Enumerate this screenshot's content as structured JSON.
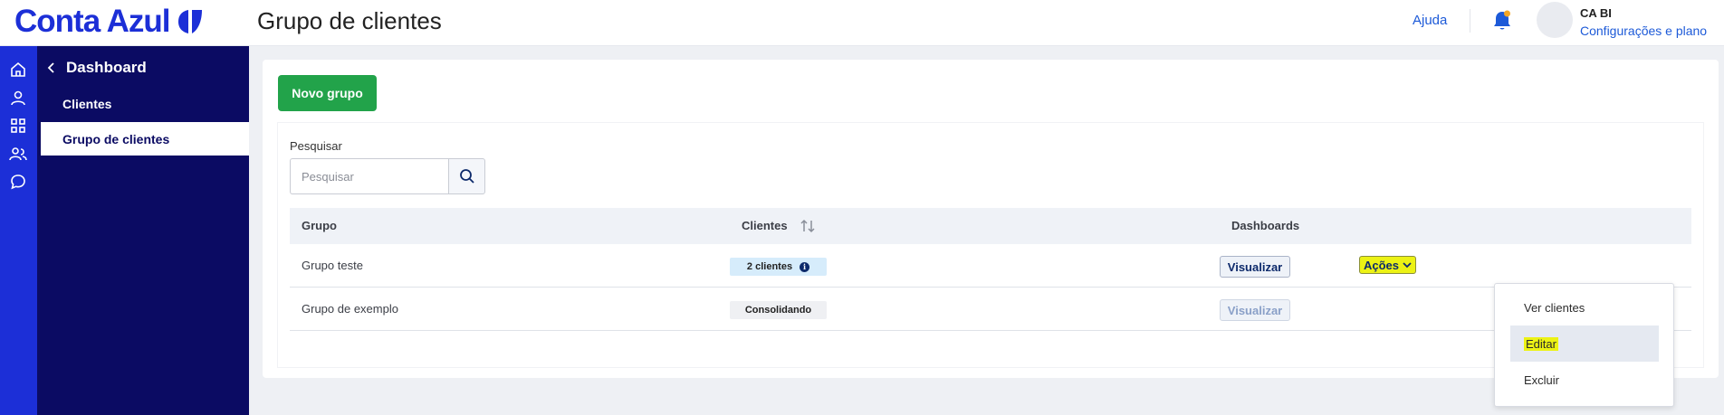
{
  "brand": {
    "name": "Conta Azul",
    "color": "#1c2fd7"
  },
  "header": {
    "title": "Grupo de clientes",
    "help": "Ajuda",
    "user_name": "CA BI",
    "user_link": "Configurações e plano"
  },
  "rail": {
    "icons": [
      "home-icon",
      "user-icon",
      "grid-icon",
      "users-icon",
      "chat-icon"
    ]
  },
  "sidebar": {
    "back_label": "Dashboard",
    "items": [
      {
        "label": "Clientes",
        "active": false
      },
      {
        "label": "Grupo de clientes",
        "active": true
      }
    ]
  },
  "toolbar": {
    "new_group": "Novo grupo"
  },
  "search": {
    "label": "Pesquisar",
    "placeholder": "Pesquisar",
    "value": ""
  },
  "table": {
    "columns": [
      "Grupo",
      "Clientes",
      "Dashboards"
    ],
    "rows": [
      {
        "group": "Grupo teste",
        "clients": "2 clientes",
        "view": "Visualizar",
        "actions": "Ações"
      },
      {
        "group": "Grupo de exemplo",
        "clients": "Consolidando",
        "view": "Visualizar"
      }
    ]
  },
  "dropdown": {
    "items": [
      "Ver clientes",
      "Editar",
      "Excluir"
    ],
    "highlighted": "Editar"
  },
  "colors": {
    "primary_button": "#22a34a",
    "sidebar_bg": "#0b0b63",
    "rail_bg": "#1c2fd7",
    "highlight": "#ecf214",
    "link": "#1d5ad8"
  }
}
